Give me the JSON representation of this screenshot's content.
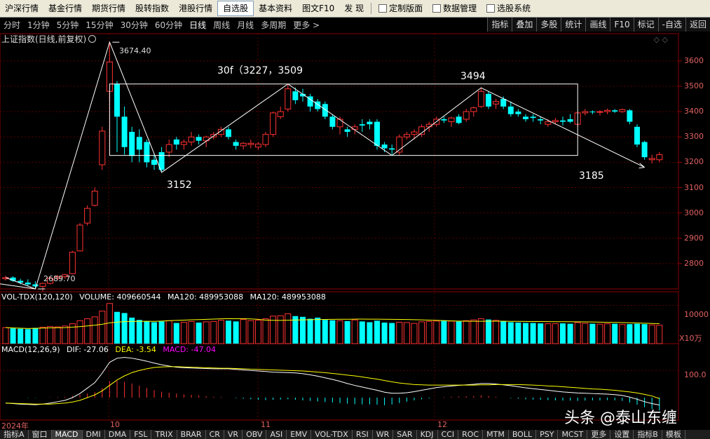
{
  "menu": [
    {
      "label": "沪深行情",
      "active": false
    },
    {
      "label": "基金行情",
      "active": false
    },
    {
      "label": "期货行情",
      "active": false
    },
    {
      "label": "股转指数",
      "active": false
    },
    {
      "label": "港股行情",
      "active": false
    },
    {
      "label": "自选股",
      "active": true
    },
    {
      "label": "基本资料",
      "active": false
    },
    {
      "label": "图文F10",
      "active": false
    },
    {
      "label": "发  现",
      "active": false
    },
    {
      "label": "定制版面",
      "active": false,
      "icon": true
    },
    {
      "label": "数据管理",
      "active": false,
      "icon": true
    },
    {
      "label": "选股系统",
      "active": false,
      "icon": true
    }
  ],
  "periods": [
    "分时",
    "1分钟",
    "5分钟",
    "15分钟",
    "30分钟",
    "60分钟",
    "日线",
    "周线",
    "月线",
    "多周期",
    "更多 >"
  ],
  "active_period": "日线",
  "right_buttons": [
    "指标",
    "叠加",
    "多股",
    "统计",
    "画线",
    "F10",
    "标记",
    "-自选",
    "返回"
  ],
  "main_title": "上证指数(日线,前复权)",
  "price_axis": [
    "3600",
    "3500",
    "3400",
    "3300",
    "3200",
    "3100",
    "3000",
    "2900",
    "2800"
  ],
  "annotations": {
    "high_label": "3674.40",
    "low_label": "2689.70",
    "box_label": "30f（3227，3509",
    "peak2": "3494",
    "trough1": "3152",
    "trough2": "3185"
  },
  "volume": {
    "name": "VOL-TDX(120,120)",
    "volume_label": "VOLUME: 409660544",
    "ma_label_1": "MA120: 489953088",
    "ma_label_2": "MA120: 489953088",
    "axis": "10000",
    "unit": "X10万"
  },
  "macd": {
    "name": "MACD(12,26,9)",
    "dif": "DIF: -27.06",
    "dea": "DEA: -3.54",
    "macd": "MACD: -47.04",
    "axis": "100.0"
  },
  "x_axis": [
    "2024年",
    "10",
    "11",
    "12"
  ],
  "bottom_tabs": [
    "指标A",
    "窗口",
    "MACD",
    "DMI",
    "DMA",
    "FSL",
    "TRIX",
    "BRAR",
    "CR",
    "VR",
    "OBV",
    "ASI",
    "EMV",
    "VOL-TDX",
    "RSI",
    "WR",
    "SAR",
    "KDJ",
    "CCI",
    "ROC",
    "MTM",
    "BOLL",
    "PSY",
    "MCST",
    "更多",
    "设置",
    "指标B",
    "模板"
  ],
  "active_tab": "MACD",
  "watermark": "头条 @泰山东缠",
  "colors": {
    "up": "#ff3232",
    "down": "#00ffff",
    "ma": "#ffffff",
    "dea": "#ffff00"
  },
  "chart_data": {
    "type": "candlestick",
    "title": "上证指数(日线,前复权)",
    "ylim": [
      2700,
      3680
    ],
    "candles": [
      {
        "o": 2740,
        "h": 2752,
        "l": 2733,
        "c": 2745
      },
      {
        "o": 2745,
        "h": 2750,
        "l": 2728,
        "c": 2732
      },
      {
        "o": 2732,
        "h": 2740,
        "l": 2718,
        "c": 2725
      },
      {
        "o": 2725,
        "h": 2738,
        "l": 2712,
        "c": 2718
      },
      {
        "o": 2718,
        "h": 2730,
        "l": 2700,
        "c": 2710
      },
      {
        "o": 2710,
        "h": 2725,
        "l": 2690,
        "c": 2722
      },
      {
        "o": 2722,
        "h": 2748,
        "l": 2718,
        "c": 2742
      },
      {
        "o": 2742,
        "h": 2755,
        "l": 2735,
        "c": 2748
      },
      {
        "o": 2748,
        "h": 2760,
        "l": 2740,
        "c": 2756
      },
      {
        "o": 2760,
        "h": 2850,
        "l": 2758,
        "c": 2845
      },
      {
        "o": 2850,
        "h": 2960,
        "l": 2848,
        "c": 2952
      },
      {
        "o": 2960,
        "h": 3030,
        "l": 2950,
        "c": 3018
      },
      {
        "o": 3030,
        "h": 3100,
        "l": 3025,
        "c": 3086
      },
      {
        "o": 3190,
        "h": 3340,
        "l": 3170,
        "c": 3323
      },
      {
        "o": 3480,
        "h": 3674,
        "l": 3440,
        "c": 3596
      },
      {
        "o": 3510,
        "h": 3520,
        "l": 3240,
        "c": 3380
      },
      {
        "o": 3380,
        "h": 3420,
        "l": 3230,
        "c": 3260
      },
      {
        "o": 3320,
        "h": 3340,
        "l": 3200,
        "c": 3225
      },
      {
        "o": 3300,
        "h": 3330,
        "l": 3200,
        "c": 3250
      },
      {
        "o": 3280,
        "h": 3290,
        "l": 3180,
        "c": 3200
      },
      {
        "o": 3210,
        "h": 3230,
        "l": 3170,
        "c": 3190
      },
      {
        "o": 3240,
        "h": 3260,
        "l": 3160,
        "c": 3170
      },
      {
        "o": 3240,
        "h": 3290,
        "l": 3220,
        "c": 3270
      },
      {
        "o": 3290,
        "h": 3300,
        "l": 3250,
        "c": 3270
      },
      {
        "o": 3270,
        "h": 3290,
        "l": 3250,
        "c": 3280
      },
      {
        "o": 3280,
        "h": 3320,
        "l": 3265,
        "c": 3300
      },
      {
        "o": 3300,
        "h": 3310,
        "l": 3270,
        "c": 3285
      },
      {
        "o": 3285,
        "h": 3305,
        "l": 3260,
        "c": 3300
      },
      {
        "o": 3300,
        "h": 3320,
        "l": 3290,
        "c": 3310
      },
      {
        "o": 3310,
        "h": 3340,
        "l": 3300,
        "c": 3330
      },
      {
        "o": 3330,
        "h": 3340,
        "l": 3290,
        "c": 3300
      },
      {
        "o": 3280,
        "h": 3290,
        "l": 3250,
        "c": 3265
      },
      {
        "o": 3265,
        "h": 3280,
        "l": 3250,
        "c": 3275
      },
      {
        "o": 3270,
        "h": 3290,
        "l": 3255,
        "c": 3275
      },
      {
        "o": 3260,
        "h": 3280,
        "l": 3250,
        "c": 3272
      },
      {
        "o": 3270,
        "h": 3320,
        "l": 3260,
        "c": 3310
      },
      {
        "o": 3310,
        "h": 3400,
        "l": 3300,
        "c": 3395
      },
      {
        "o": 3380,
        "h": 3420,
        "l": 3370,
        "c": 3400
      },
      {
        "o": 3410,
        "h": 3509,
        "l": 3400,
        "c": 3490
      },
      {
        "o": 3480,
        "h": 3495,
        "l": 3430,
        "c": 3445
      },
      {
        "o": 3470,
        "h": 3490,
        "l": 3440,
        "c": 3460
      },
      {
        "o": 3460,
        "h": 3470,
        "l": 3400,
        "c": 3420
      },
      {
        "o": 3440,
        "h": 3450,
        "l": 3400,
        "c": 3410
      },
      {
        "o": 3430,
        "h": 3440,
        "l": 3370,
        "c": 3380
      },
      {
        "o": 3380,
        "h": 3390,
        "l": 3330,
        "c": 3340
      },
      {
        "o": 3340,
        "h": 3380,
        "l": 3310,
        "c": 3370
      },
      {
        "o": 3330,
        "h": 3340,
        "l": 3300,
        "c": 3320
      },
      {
        "o": 3330,
        "h": 3350,
        "l": 3310,
        "c": 3340
      },
      {
        "o": 3350,
        "h": 3370,
        "l": 3320,
        "c": 3345
      },
      {
        "o": 3360,
        "h": 3370,
        "l": 3330,
        "c": 3350
      },
      {
        "o": 3360,
        "h": 3370,
        "l": 3250,
        "c": 3265
      },
      {
        "o": 3270,
        "h": 3280,
        "l": 3240,
        "c": 3255
      },
      {
        "o": 3255,
        "h": 3270,
        "l": 3230,
        "c": 3250
      },
      {
        "o": 3240,
        "h": 3310,
        "l": 3227,
        "c": 3300
      },
      {
        "o": 3300,
        "h": 3320,
        "l": 3290,
        "c": 3310
      },
      {
        "o": 3310,
        "h": 3330,
        "l": 3290,
        "c": 3320
      },
      {
        "o": 3310,
        "h": 3350,
        "l": 3300,
        "c": 3340
      },
      {
        "o": 3340,
        "h": 3360,
        "l": 3320,
        "c": 3350
      },
      {
        "o": 3350,
        "h": 3380,
        "l": 3340,
        "c": 3370
      },
      {
        "o": 3370,
        "h": 3380,
        "l": 3355,
        "c": 3365
      },
      {
        "o": 3360,
        "h": 3380,
        "l": 3340,
        "c": 3375
      },
      {
        "o": 3380,
        "h": 3390,
        "l": 3350,
        "c": 3355
      },
      {
        "o": 3370,
        "h": 3410,
        "l": 3360,
        "c": 3400
      },
      {
        "o": 3400,
        "h": 3420,
        "l": 3380,
        "c": 3415
      },
      {
        "o": 3420,
        "h": 3494,
        "l": 3415,
        "c": 3480
      },
      {
        "o": 3470,
        "h": 3480,
        "l": 3410,
        "c": 3420
      },
      {
        "o": 3430,
        "h": 3450,
        "l": 3410,
        "c": 3440
      },
      {
        "o": 3450,
        "h": 3460,
        "l": 3410,
        "c": 3420
      },
      {
        "o": 3420,
        "h": 3440,
        "l": 3380,
        "c": 3390
      },
      {
        "o": 3400,
        "h": 3410,
        "l": 3380,
        "c": 3390
      },
      {
        "o": 3380,
        "h": 3390,
        "l": 3360,
        "c": 3370
      },
      {
        "o": 3380,
        "h": 3390,
        "l": 3360,
        "c": 3375
      },
      {
        "o": 3370,
        "h": 3380,
        "l": 3350,
        "c": 3365
      },
      {
        "o": 3350,
        "h": 3370,
        "l": 3340,
        "c": 3360
      },
      {
        "o": 3360,
        "h": 3375,
        "l": 3350,
        "c": 3365
      },
      {
        "o": 3365,
        "h": 3380,
        "l": 3345,
        "c": 3360
      },
      {
        "o": 3370,
        "h": 3390,
        "l": 3355,
        "c": 3360
      },
      {
        "o": 3350,
        "h": 3400,
        "l": 3340,
        "c": 3395
      },
      {
        "o": 3395,
        "h": 3410,
        "l": 3385,
        "c": 3400
      },
      {
        "o": 3400,
        "h": 3405,
        "l": 3390,
        "c": 3398
      },
      {
        "o": 3398,
        "h": 3405,
        "l": 3385,
        "c": 3400
      },
      {
        "o": 3400,
        "h": 3412,
        "l": 3390,
        "c": 3405
      },
      {
        "o": 3405,
        "h": 3410,
        "l": 3395,
        "c": 3400
      },
      {
        "o": 3400,
        "h": 3412,
        "l": 3395,
        "c": 3408
      },
      {
        "o": 3405,
        "h": 3410,
        "l": 3350,
        "c": 3360
      },
      {
        "o": 3340,
        "h": 3350,
        "l": 3260,
        "c": 3270
      },
      {
        "o": 3280,
        "h": 3285,
        "l": 3210,
        "c": 3220
      },
      {
        "o": 3210,
        "h": 3230,
        "l": 3195,
        "c": 3215
      },
      {
        "o": 3210,
        "h": 3240,
        "l": 3200,
        "c": 3230
      }
    ],
    "volume": [
      4.2,
      4.0,
      3.9,
      3.8,
      4.1,
      4.3,
      4.5,
      4.4,
      4.6,
      5.2,
      6.0,
      6.5,
      7.0,
      8.5,
      10.5,
      8.3,
      8.0,
      6.8,
      6.2,
      5.9,
      5.6,
      5.8,
      6.0,
      5.4,
      5.6,
      5.8,
      5.5,
      5.7,
      5.8,
      6.1,
      6.0,
      5.8,
      6.3,
      6.0,
      6.1,
      6.5,
      7.2,
      7.3,
      7.8,
      7.2,
      7.0,
      6.5,
      6.8,
      6.2,
      6.1,
      6.0,
      5.9,
      6.2,
      5.8,
      5.6,
      6.0,
      5.5,
      5.4,
      5.6,
      5.5,
      5.3,
      5.7,
      5.8,
      5.9,
      6.1,
      5.9,
      5.8,
      6.0,
      6.2,
      6.5,
      6.3,
      6.1,
      5.8,
      5.6,
      5.5,
      5.4,
      5.4,
      5.3,
      5.2,
      5.2,
      5.3,
      5.2,
      5.5,
      5.3,
      5.2,
      5.1,
      5.2,
      5.2,
      5.0,
      5.1,
      5.2,
      5.1,
      4.9,
      4.8
    ],
    "volume_ylim": [
      0,
      11
    ],
    "macd": [
      0,
      0,
      0,
      -1,
      -1,
      0,
      1,
      2,
      3,
      6,
      10,
      15,
      20,
      35,
      60,
      62,
      58,
      52,
      44,
      36,
      28,
      22,
      18,
      15,
      12,
      10,
      8,
      5,
      3,
      2,
      0,
      -2,
      -4,
      -6,
      -8,
      -9,
      -8,
      -7,
      -6,
      -8,
      -10,
      -12,
      -14,
      -16,
      -18,
      -20,
      -22,
      -24,
      -25,
      -25,
      -26,
      -28,
      -25,
      -20,
      -15,
      -10,
      -6,
      -3,
      0,
      2,
      3,
      4,
      5,
      6,
      8,
      6,
      3,
      0,
      -2,
      -4,
      -6,
      -7,
      -8,
      -9,
      -10,
      -11,
      -11,
      -12,
      -11,
      -10,
      -10,
      -9,
      -10,
      -12,
      -18,
      -26,
      -35,
      -42,
      -47
    ],
    "dif": [
      -20,
      -22,
      -24,
      -25,
      -26,
      -24,
      -20,
      -15,
      -10,
      0,
      15,
      35,
      55,
      90,
      130,
      145,
      148,
      145,
      140,
      134,
      127,
      121,
      116,
      112,
      110,
      109,
      108,
      107,
      106,
      106,
      106,
      104,
      102,
      100,
      98,
      96,
      94,
      93,
      92,
      91,
      88,
      84,
      79,
      73,
      67,
      60,
      52,
      45,
      39,
      33,
      27,
      20,
      16,
      16,
      18,
      22,
      27,
      32,
      37,
      40,
      43,
      45,
      47,
      49,
      52,
      52,
      50,
      47,
      44,
      40,
      36,
      33,
      30,
      27,
      24,
      21,
      19,
      17,
      16,
      15,
      14,
      13,
      11,
      8,
      2,
      -6,
      -15,
      -22,
      -27
    ],
    "dea": [
      -20,
      -21,
      -22,
      -23,
      -24,
      -24,
      -24,
      -22,
      -20,
      -16,
      -10,
      0,
      10,
      25,
      45,
      65,
      80,
      92,
      100,
      106,
      111,
      113,
      114,
      114,
      113,
      112,
      111,
      110,
      109,
      108,
      108,
      107,
      106,
      105,
      104,
      103,
      102,
      101,
      100,
      99,
      98,
      96,
      94,
      92,
      89,
      86,
      83,
      80,
      76,
      72,
      68,
      63,
      58,
      54,
      51,
      48,
      47,
      46,
      46,
      46,
      46,
      46,
      46,
      46,
      47,
      47,
      48,
      48,
      48,
      48,
      47,
      46,
      45,
      43,
      42,
      40,
      38,
      36,
      34,
      32,
      31,
      29,
      27,
      24,
      21,
      17,
      12,
      6,
      -3.5
    ],
    "macd_ylim": [
      -80,
      160
    ]
  }
}
